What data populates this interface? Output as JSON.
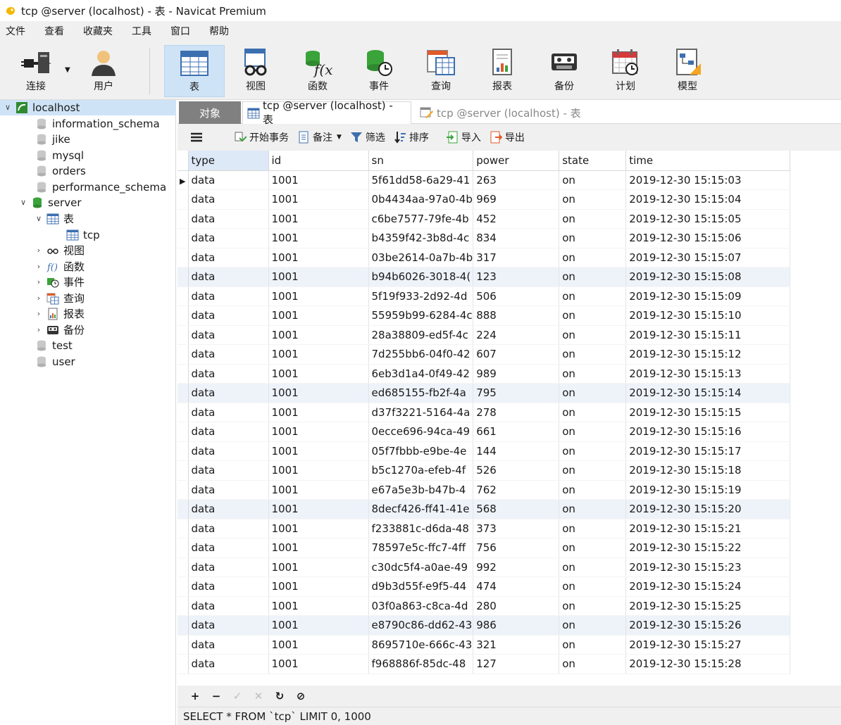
{
  "window": {
    "title": "tcp @server (localhost) - 表 - Navicat Premium"
  },
  "menu": [
    "文件",
    "查看",
    "收藏夹",
    "工具",
    "窗口",
    "帮助"
  ],
  "toolbar": {
    "connect": "连接",
    "user": "用户",
    "table": "表",
    "view": "视图",
    "function": "函数",
    "event": "事件",
    "query": "查询",
    "report": "报表",
    "backup": "备份",
    "schedule": "计划",
    "model": "模型"
  },
  "sidebar": {
    "connection": "localhost",
    "databases": [
      "information_schema",
      "jike",
      "mysql",
      "orders",
      "performance_schema"
    ],
    "server_db": "server",
    "tables_group": "表",
    "table": "tcp",
    "groups": [
      "视图",
      "函数",
      "事件",
      "查询",
      "报表",
      "备份"
    ],
    "tail_dbs": [
      "test",
      "user"
    ]
  },
  "tabs": {
    "objects": "对象",
    "tab1": "tcp @server (localhost) - 表",
    "tab2": "tcp @server (localhost) - 表"
  },
  "subtoolbar": {
    "begin_tx": "开始事务",
    "memo": "备注",
    "filter": "筛选",
    "sort": "排序",
    "import": "导入",
    "export": "导出"
  },
  "grid": {
    "columns": [
      "type",
      "id",
      "sn",
      "power",
      "state",
      "time"
    ],
    "rows": [
      [
        "data",
        "1001",
        "5f61dd58-6a29-41",
        "263",
        "on",
        "2019-12-30 15:15:03"
      ],
      [
        "data",
        "1001",
        "0b4434aa-97a0-4b",
        "969",
        "on",
        "2019-12-30 15:15:04"
      ],
      [
        "data",
        "1001",
        "c6be7577-79fe-4b",
        "452",
        "on",
        "2019-12-30 15:15:05"
      ],
      [
        "data",
        "1001",
        "b4359f42-3b8d-4c",
        "834",
        "on",
        "2019-12-30 15:15:06"
      ],
      [
        "data",
        "1001",
        "03be2614-0a7b-4b",
        "317",
        "on",
        "2019-12-30 15:15:07"
      ],
      [
        "data",
        "1001",
        "b94b6026-3018-4(",
        "123",
        "on",
        "2019-12-30 15:15:08"
      ],
      [
        "data",
        "1001",
        "5f19f933-2d92-4d",
        "506",
        "on",
        "2019-12-30 15:15:09"
      ],
      [
        "data",
        "1001",
        "55959b99-6284-4c",
        "888",
        "on",
        "2019-12-30 15:15:10"
      ],
      [
        "data",
        "1001",
        "28a38809-ed5f-4c",
        "224",
        "on",
        "2019-12-30 15:15:11"
      ],
      [
        "data",
        "1001",
        "7d255bb6-04f0-42",
        "607",
        "on",
        "2019-12-30 15:15:12"
      ],
      [
        "data",
        "1001",
        "6eb3d1a4-0f49-42",
        "989",
        "on",
        "2019-12-30 15:15:13"
      ],
      [
        "data",
        "1001",
        "ed685155-fb2f-4a",
        "795",
        "on",
        "2019-12-30 15:15:14"
      ],
      [
        "data",
        "1001",
        "d37f3221-5164-4a",
        "278",
        "on",
        "2019-12-30 15:15:15"
      ],
      [
        "data",
        "1001",
        "0ecce696-94ca-49",
        "661",
        "on",
        "2019-12-30 15:15:16"
      ],
      [
        "data",
        "1001",
        "05f7fbbb-e9be-4e",
        "144",
        "on",
        "2019-12-30 15:15:17"
      ],
      [
        "data",
        "1001",
        "b5c1270a-efeb-4f",
        "526",
        "on",
        "2019-12-30 15:15:18"
      ],
      [
        "data",
        "1001",
        "e67a5e3b-b47b-4",
        "762",
        "on",
        "2019-12-30 15:15:19"
      ],
      [
        "data",
        "1001",
        "8decf426-ff41-41e",
        "568",
        "on",
        "2019-12-30 15:15:20"
      ],
      [
        "data",
        "1001",
        "f233881c-d6da-48",
        "373",
        "on",
        "2019-12-30 15:15:21"
      ],
      [
        "data",
        "1001",
        "78597e5c-ffc7-4ff",
        "756",
        "on",
        "2019-12-30 15:15:22"
      ],
      [
        "data",
        "1001",
        "c30dc5f4-a0ae-49",
        "992",
        "on",
        "2019-12-30 15:15:23"
      ],
      [
        "data",
        "1001",
        "d9b3d55f-e9f5-44",
        "474",
        "on",
        "2019-12-30 15:15:24"
      ],
      [
        "data",
        "1001",
        "03f0a863-c8ca-4d",
        "280",
        "on",
        "2019-12-30 15:15:25"
      ],
      [
        "data",
        "1001",
        "e8790c86-dd62-43",
        "986",
        "on",
        "2019-12-30 15:15:26"
      ],
      [
        "data",
        "1001",
        "8695710e-666c-43",
        "321",
        "on",
        "2019-12-30 15:15:27"
      ],
      [
        "data",
        "1001",
        "f968886f-85dc-48",
        "127",
        "on",
        "2019-12-30 15:15:28"
      ]
    ]
  },
  "footer": {
    "add": "+",
    "remove": "−",
    "apply": "✓",
    "cancel": "✕",
    "refresh": "↻",
    "stop": "⊘"
  },
  "status": {
    "sql": "SELECT * FROM `tcp` LIMIT 0, 1000"
  },
  "colors": {
    "accent": "#cfe3f6",
    "chrome": "#f0f0f0",
    "db_icon": "#3aa33a",
    "active_tab": "#808080"
  }
}
